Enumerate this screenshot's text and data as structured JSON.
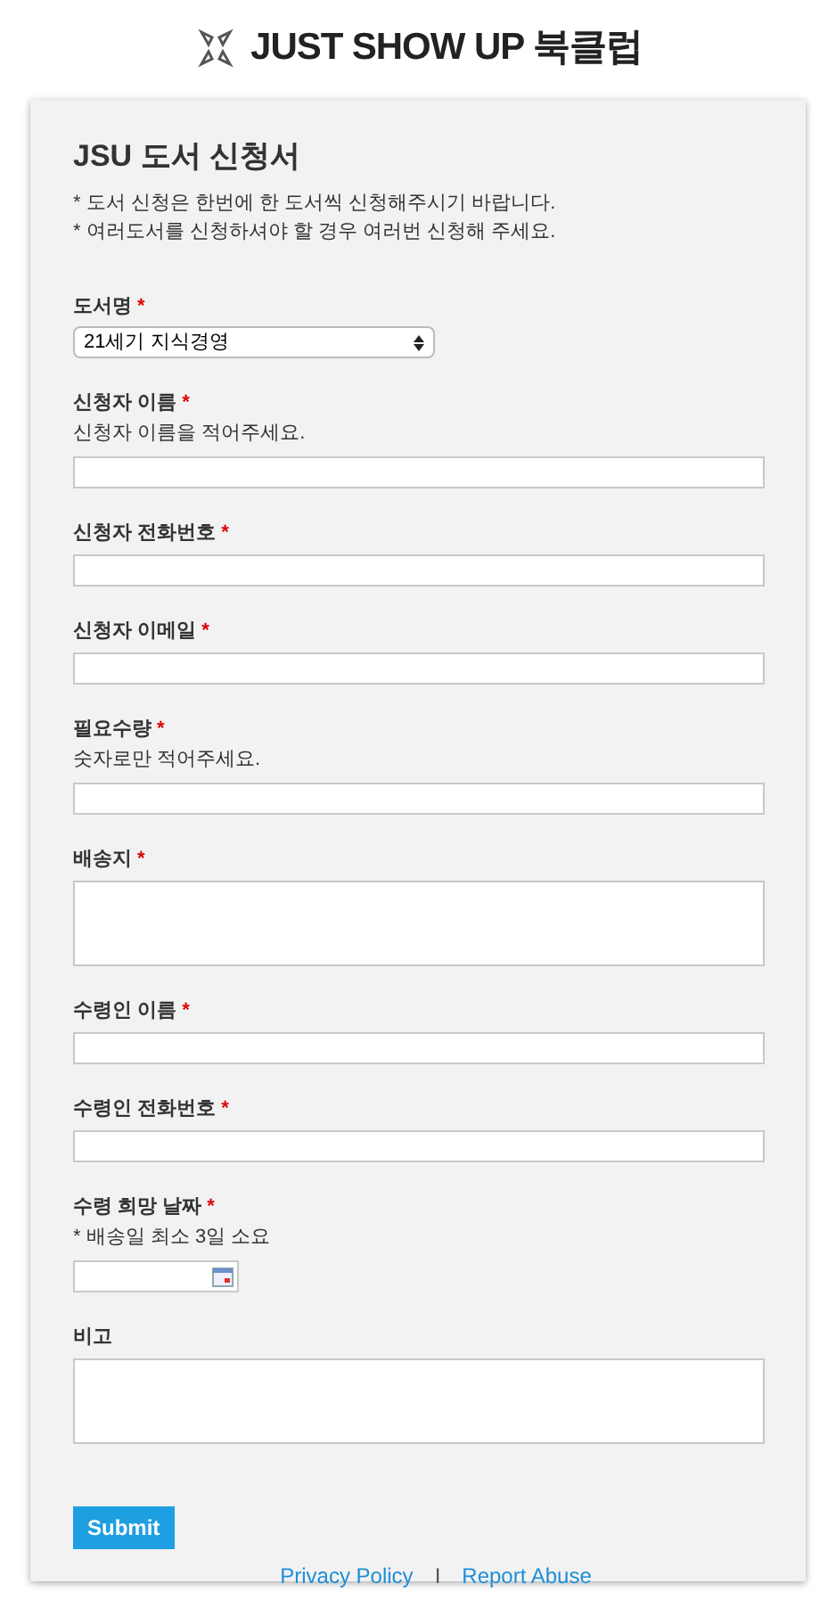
{
  "brand": "JUST SHOW UP 북클럽",
  "form": {
    "title": "JSU 도서 신청서",
    "notes": [
      "* 도서 신청은 한번에 한 도서씩 신청해주시기 바랍니다.",
      "* 여러도서를 신청하셔야 할 경우 여러번 신청해 주세요."
    ],
    "fields": [
      {
        "kind": "select",
        "label": "도서명",
        "required_mark": "*",
        "value": "21세기 지식경영"
      },
      {
        "kind": "text",
        "label": "신청자 이름",
        "required_mark": "*",
        "hint": "신청자 이름을 적어주세요."
      },
      {
        "kind": "text",
        "label": "신청자 전화번호",
        "required_mark": "*"
      },
      {
        "kind": "text",
        "label": "신청자 이메일",
        "required_mark": "*"
      },
      {
        "kind": "text",
        "label": "필요수량",
        "required_mark": "*",
        "hint": "숫자로만 적어주세요."
      },
      {
        "kind": "textarea",
        "label": "배송지",
        "required_mark": "*"
      },
      {
        "kind": "text",
        "label": "수령인 이름",
        "required_mark": "*"
      },
      {
        "kind": "text",
        "label": "수령인 전화번호",
        "required_mark": "*"
      },
      {
        "kind": "date",
        "label": "수령 희망 날짜",
        "required_mark": "*",
        "hint": "* 배송일 최소 3일 소요"
      },
      {
        "kind": "textarea",
        "label": "비고"
      }
    ],
    "submit": "Submit"
  },
  "footer": {
    "links": [
      "Privacy Policy",
      "Report Abuse"
    ],
    "separator": "I"
  }
}
